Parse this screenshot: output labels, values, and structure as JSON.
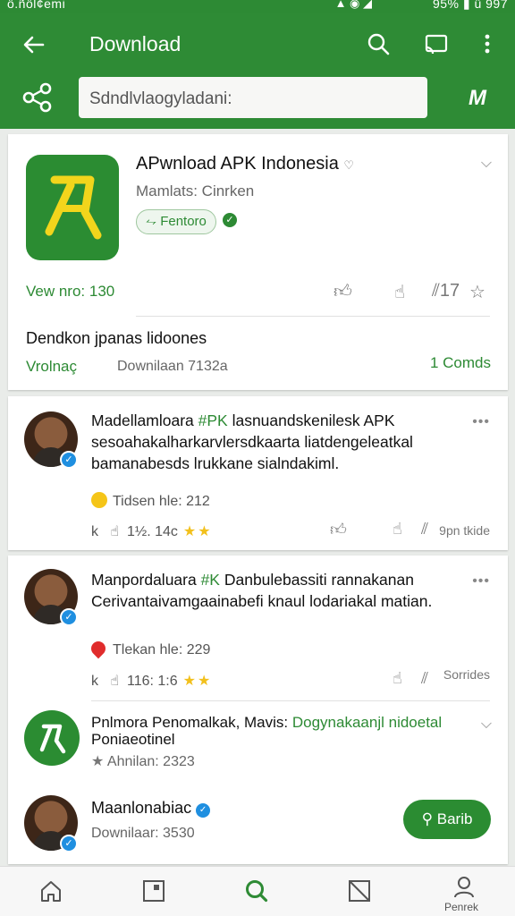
{
  "status_bar": {
    "left": "ö.ñöl¢emi",
    "right": "95%",
    "time": "ü 997"
  },
  "app_bar": {
    "title": "Download",
    "search_value": "Sdndlvlaogyladani:"
  },
  "featured_app": {
    "title": "APwnload APK Indonesia",
    "subtitle": "Mamlats: Cinrken",
    "tag": "Fentoro",
    "views": "Vew nro: 130",
    "description": "Dendkon jpanas lidoones",
    "download_label": "Vrolnaç",
    "download_value": "Downilaan 7132a",
    "comments": "1 Comds",
    "metric": "17"
  },
  "posts": [
    {
      "text_before": "Madellamloara ",
      "hashtag": "#PK",
      "text_after": " lasnuandskenilesk APK sesoahakalharkarvlersdkaarta liatdengeleatkal bamanabesds lrukkane sialndakiml.",
      "reaction": "Tidsen hle: 212",
      "meta": "1½. 14c",
      "letter": "k",
      "side": "9pn tkide"
    },
    {
      "text_before": "Manpordaluara ",
      "hashtag": "#K",
      "text_after": " Danbulebassiti rannakanan Cerivantaivamgaainabefi knaul lodariakal matian.",
      "reaction": "Tlekan hle: 229",
      "meta": "116: 1:6",
      "letter": "k",
      "side": "Sorrides"
    }
  ],
  "recommended": {
    "title_before": "Pnlmora Penomalkak, Mavis: ",
    "title_highlight": "Dogynakaanjl nidoetal",
    "title_after": "Poniaeotinel",
    "subtitle": "Ahnilan: 2323"
  },
  "profile": {
    "name": "Maanlonabiac",
    "subtitle": "Downilaar: 3530",
    "follow_label": "Barib"
  },
  "bottom_nav": {
    "profile_label": "Penrek"
  },
  "colors": {
    "primary": "#2e8b35",
    "verified": "#1f8fe0",
    "star": "#f2c01c"
  }
}
